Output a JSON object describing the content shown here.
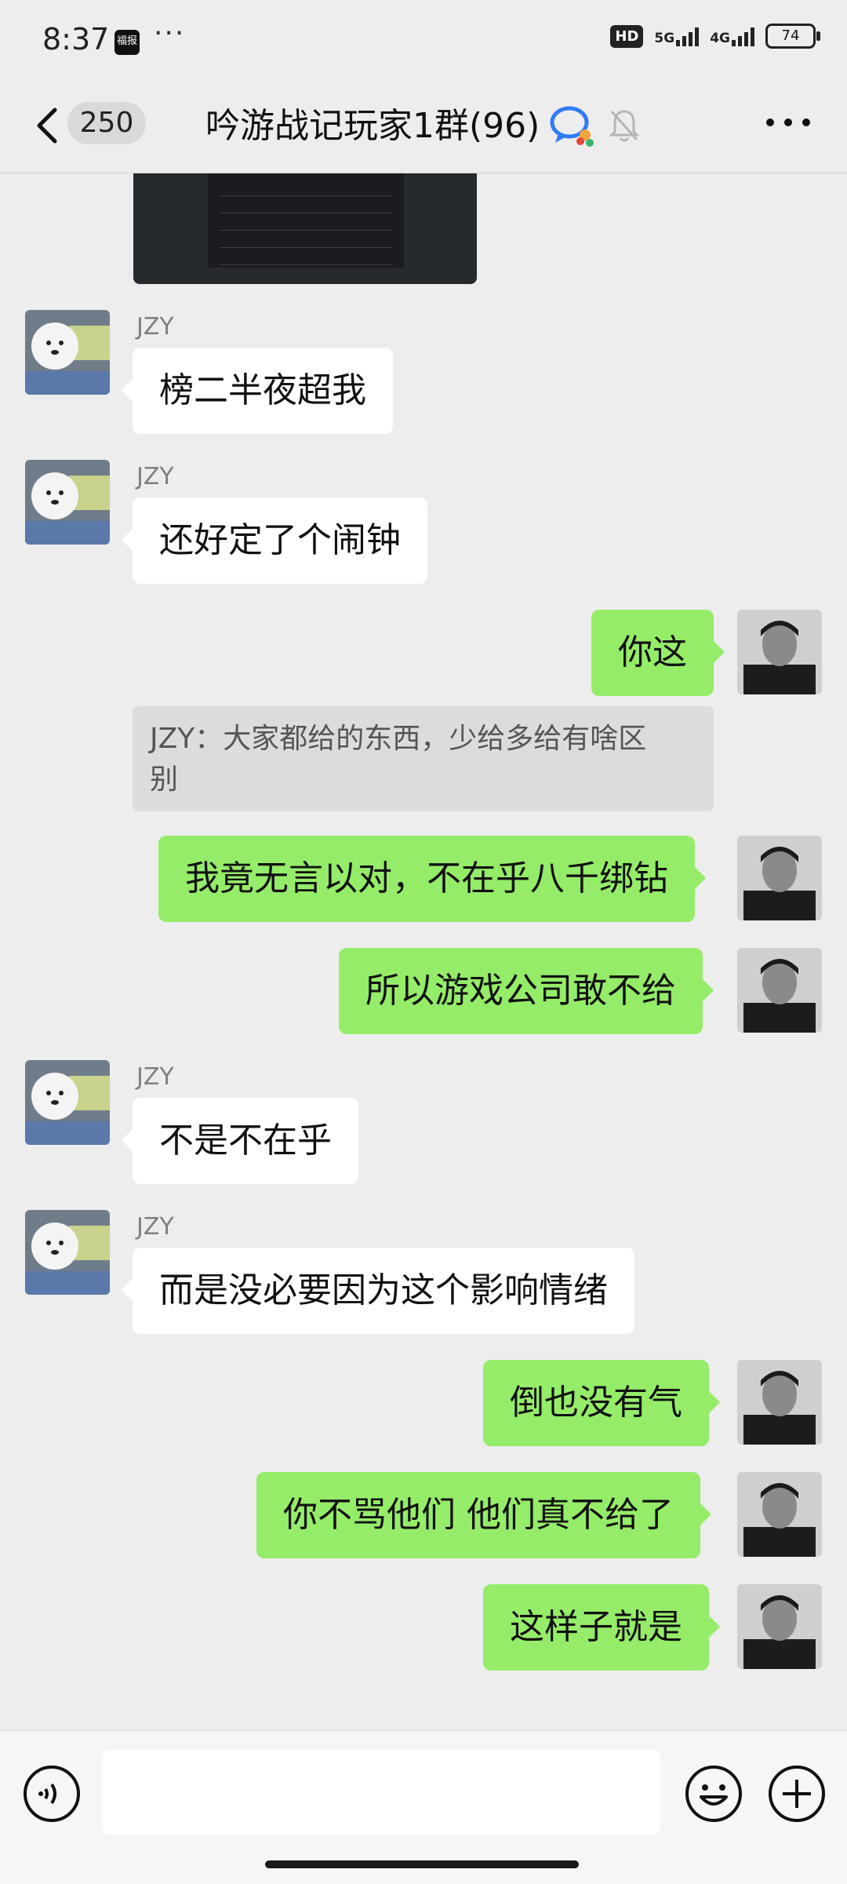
{
  "status_bar": {
    "time": "8:37",
    "app_icon_text": "福报",
    "overflow": "···",
    "hd_badge": "HD",
    "net1": "5G",
    "net2": "4G",
    "battery": "74"
  },
  "header": {
    "unread_count": "250",
    "title": "吟游战记玩家1群(96)"
  },
  "messages": {
    "sender_name": "JZY",
    "m1": "榜二半夜超我",
    "m2": "还好定了个闹钟",
    "m3": "你这",
    "quote_line1": "JZY：大家都给的东西，少给多给有啥区",
    "quote_line2": "别",
    "m4": "我竟无言以对，不在乎八千绑钻",
    "m5": "所以游戏公司敢不给",
    "m6": "不是不在乎",
    "m7": "而是没必要因为这个影响情绪",
    "m8": "倒也没有气",
    "m9": "你不骂他们 他们真不给了",
    "m10": "这样子就是"
  },
  "colors": {
    "background": "#ededed",
    "own_bubble": "#95ec69",
    "other_bubble": "#ffffff",
    "name_text": "#7f7f7f"
  },
  "icons": {
    "back": "chevron-left-icon",
    "chat": "chat-bubbles-icon",
    "mute": "bell-muted-icon",
    "more": "more-dots-icon",
    "voice": "voice-icon",
    "emoji": "emoji-icon",
    "plus": "plus-icon"
  }
}
